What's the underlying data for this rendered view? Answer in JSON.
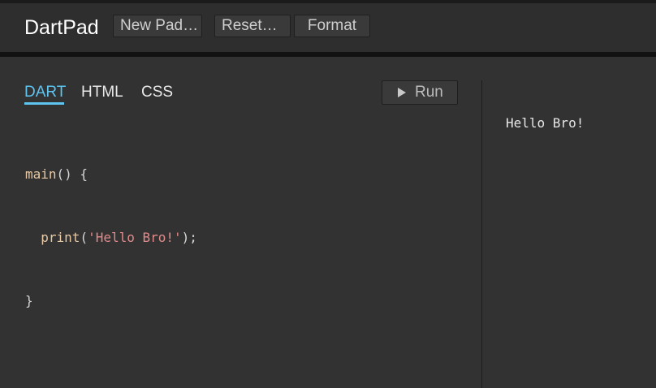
{
  "header": {
    "title": "DartPad",
    "buttons": {
      "new_pad": "New Pad…",
      "reset": "Reset…",
      "format": "Format"
    }
  },
  "editor": {
    "tabs": [
      {
        "label": "DART",
        "active": true
      },
      {
        "label": "HTML",
        "active": false
      },
      {
        "label": "CSS",
        "active": false
      }
    ],
    "run_button": {
      "label": "Run",
      "icon": "play-icon"
    },
    "code": {
      "line1": {
        "fn": "main",
        "rest": "() {"
      },
      "line2": {
        "indent": "  ",
        "fn": "print",
        "open": "(",
        "str": "'Hello Bro!'",
        "close": ");"
      },
      "line3": {
        "text": "}"
      }
    }
  },
  "output": {
    "text": "Hello Bro!"
  },
  "colors": {
    "accent": "#5ec4f0",
    "background": "#323232",
    "header_background": "#2e2e2e",
    "string": "#e08a8a",
    "function": "#e8c9a3"
  }
}
